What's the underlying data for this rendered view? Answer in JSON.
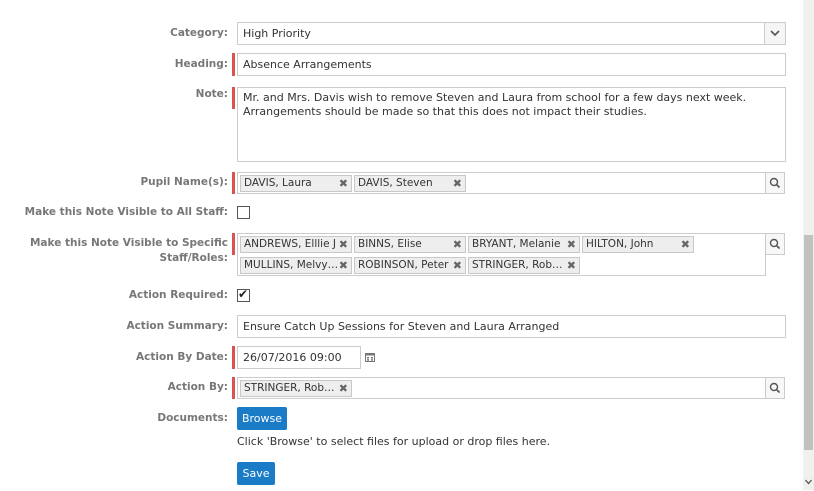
{
  "form": {
    "category": {
      "label": "Category:",
      "value": "High Priority"
    },
    "heading": {
      "label": "Heading:",
      "value": "Absence Arrangements"
    },
    "note": {
      "label": "Note:",
      "line1": "Mr. and Mrs. Davis wish to remove Steven and Laura from school for a few days next week.",
      "line2": "Arrangements should be made so that this does not impact their studies."
    },
    "pupils": {
      "label": "Pupil Name(s):",
      "tags": [
        "DAVIS, Laura",
        "DAVIS, Steven"
      ]
    },
    "visible_all": {
      "label": "Make this Note Visible to All Staff:",
      "checked": false
    },
    "visible_specific": {
      "label1": "Make this Note Visible to Specific",
      "label2": "Staff/Roles:",
      "tags": [
        "ANDREWS, Elllie J",
        "BINNS, Elise",
        "BRYANT, Melanie",
        "HILTON, John",
        "MULLINS, Melvy…",
        "ROBINSON, Peter",
        "STRINGER, Rob…"
      ]
    },
    "action_required": {
      "label": "Action Required:",
      "checked": true,
      "mark": "✔"
    },
    "action_summary": {
      "label": "Action Summary:",
      "value": "Ensure Catch Up Sessions for Steven and Laura Arranged"
    },
    "action_by_date": {
      "label": "Action By Date:",
      "value": "26/07/2016 09:00"
    },
    "action_by": {
      "label": "Action By:",
      "tags": [
        "STRINGER, Rob…"
      ]
    },
    "documents": {
      "label": "Documents:",
      "browse_label": "Browse",
      "hint": "Click 'Browse' to select files for upload or drop files here."
    },
    "save_label": "Save"
  },
  "icons": {
    "remove": "✖",
    "search": "magnifier-icon",
    "calendar": "calendar-icon",
    "dropdown": "chevron-down-icon"
  },
  "colors": {
    "required": "#d9534f",
    "button": "#1a7bc7"
  }
}
